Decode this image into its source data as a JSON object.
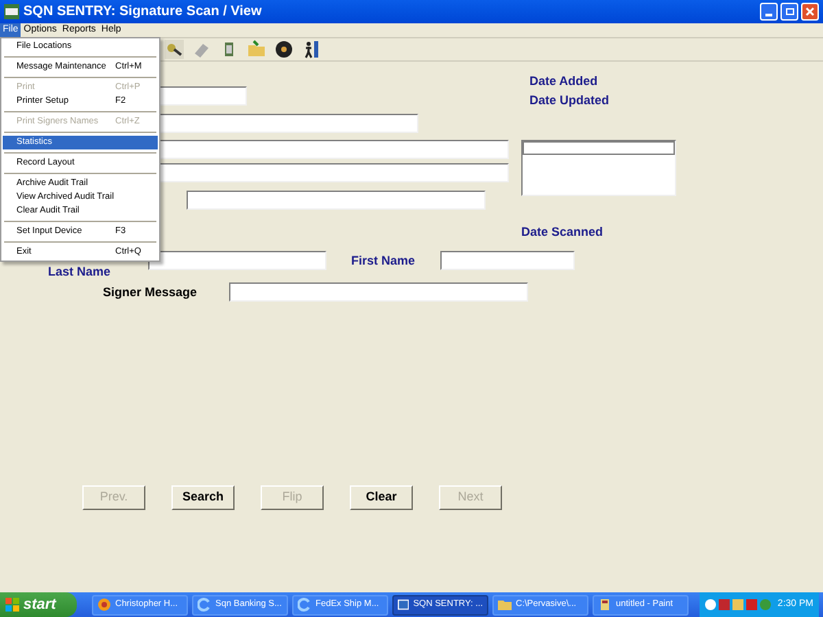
{
  "window": {
    "title": "SQN SENTRY: Signature Scan / View"
  },
  "menu_bar": [
    {
      "label": "File",
      "selected": true
    },
    {
      "label": "Options",
      "selected": false
    },
    {
      "label": "Reports",
      "selected": false
    },
    {
      "label": "Help",
      "selected": false
    }
  ],
  "file_menu": [
    {
      "kind": "item",
      "label": "File Locations",
      "disabled": false,
      "selected": false
    },
    {
      "kind": "separator"
    },
    {
      "kind": "item",
      "label": "Message Maintenance",
      "shortcut": "Ctrl+M",
      "disabled": false,
      "selected": false
    },
    {
      "kind": "separator"
    },
    {
      "kind": "item",
      "label": "Print",
      "shortcut": "Ctrl+P",
      "disabled": true,
      "selected": false
    },
    {
      "kind": "item",
      "label": "Printer Setup",
      "shortcut": "F2",
      "disabled": false,
      "selected": false
    },
    {
      "kind": "separator"
    },
    {
      "kind": "item",
      "label": "Print Signers Names",
      "shortcut": "Ctrl+Z",
      "disabled": true,
      "selected": false
    },
    {
      "kind": "separator"
    },
    {
      "kind": "item",
      "label": "Statistics",
      "disabled": false,
      "selected": true
    },
    {
      "kind": "separator"
    },
    {
      "kind": "item",
      "label": "Record Layout",
      "disabled": false,
      "selected": false
    },
    {
      "kind": "separator"
    },
    {
      "kind": "item",
      "label": "Archive Audit Trail",
      "disabled": false,
      "selected": false
    },
    {
      "kind": "item",
      "label": "View Archived Audit Trail",
      "disabled": false,
      "selected": false
    },
    {
      "kind": "item",
      "label": "Clear Audit Trail",
      "disabled": false,
      "selected": false
    },
    {
      "kind": "separator"
    },
    {
      "kind": "item",
      "label": "Set Input Device",
      "shortcut": "F3",
      "disabled": false,
      "selected": false
    },
    {
      "kind": "separator"
    },
    {
      "kind": "item",
      "label": "Exit",
      "shortcut": "Ctrl+Q",
      "disabled": false,
      "selected": false
    }
  ],
  "form": {
    "date_added_label": "Date Added",
    "date_updated_label": "Date Updated",
    "date_scanned_label": "Date Scanned",
    "last_name_label": "Last Name",
    "first_name_label": "First Name",
    "signer_message_label": "Signer Message"
  },
  "buttons": [
    {
      "label": "Prev.",
      "disabled": true
    },
    {
      "label": "Search",
      "disabled": false
    },
    {
      "label": "Flip",
      "disabled": true
    },
    {
      "label": "Clear",
      "disabled": false
    },
    {
      "label": "Next",
      "disabled": true
    }
  ],
  "taskbar": {
    "start": "start",
    "tasks": [
      {
        "label": "Christopher H...",
        "kind": "messenger",
        "selected": false
      },
      {
        "label": "Sqn Banking S...",
        "kind": "browser",
        "selected": false
      },
      {
        "label": "FedEx Ship M...",
        "kind": "browser",
        "selected": false
      },
      {
        "label": "SQN SENTRY: ...",
        "kind": "app",
        "selected": true
      },
      {
        "label": "C:\\Pervasive\\...",
        "kind": "folder",
        "selected": false
      },
      {
        "label": "untitled - Paint",
        "kind": "paint",
        "selected": false
      }
    ],
    "clock": "2:30 PM"
  }
}
